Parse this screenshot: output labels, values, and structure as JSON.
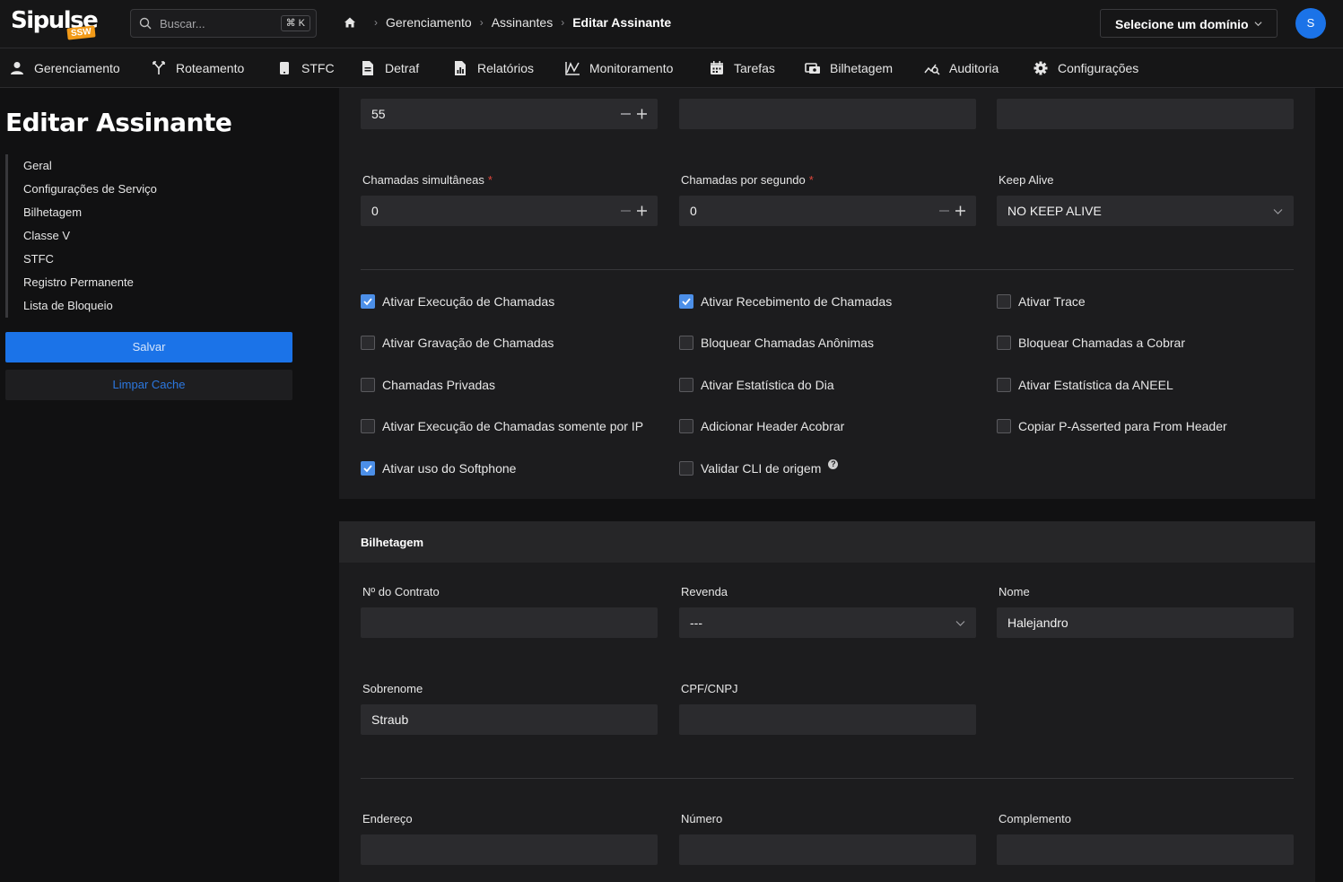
{
  "topbar": {
    "logo_text": "Sipulse",
    "logo_tag": "SSW",
    "search_placeholder": "Buscar...",
    "search_shortcut": "⌘ K",
    "breadcrumb": [
      "Gerenciamento",
      "Assinantes",
      "Editar Assinante"
    ],
    "domain_select": "Selecione um domínio",
    "avatar_initial": "S"
  },
  "nav": {
    "items": [
      "Gerenciamento",
      "Roteamento",
      "STFC",
      "Detraf",
      "Relatórios",
      "Monitoramento",
      "Tarefas",
      "Bilhetagem",
      "Auditoria",
      "Configurações"
    ]
  },
  "sidebar": {
    "title": "Editar Assinante",
    "sections": [
      "Geral",
      "Configurações de Serviço",
      "Bilhetagem",
      "Classe V",
      "STFC",
      "Registro Permanente",
      "Lista de Bloqueio"
    ],
    "save_label": "Salvar",
    "clear_cache_label": "Limpar Cache"
  },
  "service": {
    "top_row": {
      "field1_value": "55",
      "field2_value": "",
      "field3_value": ""
    },
    "simultaneous_calls": {
      "label": "Chamadas simultâneas",
      "required": "*",
      "value": "0"
    },
    "calls_per_second": {
      "label": "Chamadas por segundo",
      "required": "*",
      "value": "0"
    },
    "keep_alive": {
      "label": "Keep Alive",
      "value": "NO KEEP ALIVE"
    },
    "checkboxes": [
      {
        "label": "Ativar Execução de Chamadas",
        "checked": true
      },
      {
        "label": "Ativar Recebimento de Chamadas",
        "checked": true
      },
      {
        "label": "Ativar Trace",
        "checked": false
      },
      {
        "label": "Ativar Gravação de Chamadas",
        "checked": false
      },
      {
        "label": "Bloquear Chamadas Anônimas",
        "checked": false
      },
      {
        "label": "Bloquear Chamadas a Cobrar",
        "checked": false
      },
      {
        "label": "Chamadas Privadas",
        "checked": false
      },
      {
        "label": "Ativar Estatística do Dia",
        "checked": false
      },
      {
        "label": "Ativar Estatística da ANEEL",
        "checked": false
      },
      {
        "label": "Ativar Execução de Chamadas somente por IP",
        "checked": false
      },
      {
        "label": "Adicionar Header Acobrar",
        "checked": false
      },
      {
        "label": "Copiar P-Asserted para From Header",
        "checked": false
      },
      {
        "label": "Ativar uso do Softphone",
        "checked": true
      },
      {
        "label": "Validar CLI de origem",
        "checked": false
      }
    ],
    "help_glyph": "?"
  },
  "billing": {
    "title": "Bilhetagem",
    "contract": {
      "label": "Nº do Contrato",
      "value": ""
    },
    "reseller": {
      "label": "Revenda",
      "value": "---"
    },
    "name": {
      "label": "Nome",
      "value": "Halejandro"
    },
    "surname": {
      "label": "Sobrenome",
      "value": "Straub"
    },
    "cpf": {
      "label": "CPF/CNPJ",
      "value": ""
    },
    "address": {
      "label": "Endereço",
      "value": ""
    },
    "number": {
      "label": "Número",
      "value": ""
    },
    "complement": {
      "label": "Complemento",
      "value": ""
    }
  },
  "colors": {
    "accent": "#1b73e8",
    "checkbox_on": "#4c8fe8",
    "logo_tag": "#f29a18",
    "required": "#e0463b"
  }
}
